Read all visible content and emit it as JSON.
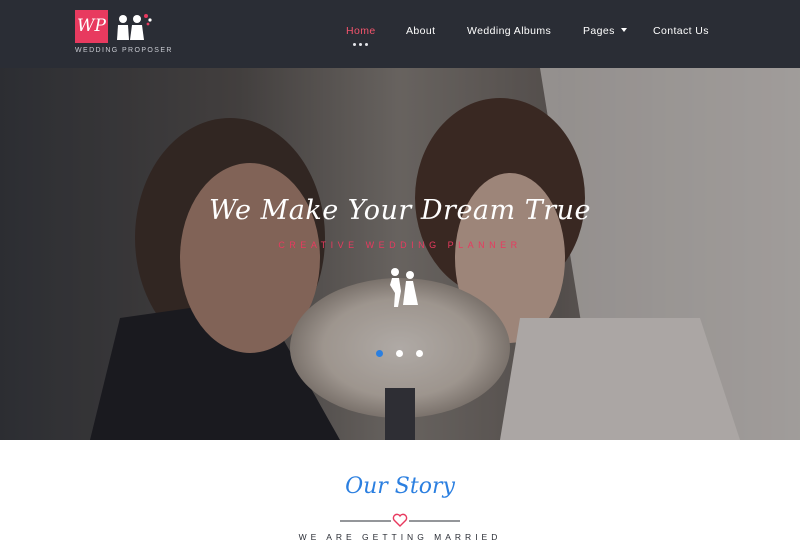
{
  "brand": {
    "logo_letters": "WP",
    "name": "WEDDING PROPOSER",
    "accent": "#e83a5f"
  },
  "nav": {
    "items": [
      {
        "label": "Home",
        "active": true
      },
      {
        "label": "About",
        "active": false
      },
      {
        "label": "Wedding Albums",
        "active": false
      },
      {
        "label": "Pages",
        "active": false,
        "has_dropdown": true
      },
      {
        "label": "Contact Us",
        "active": false
      }
    ]
  },
  "hero": {
    "title": "We Make Your Dream True",
    "subtitle": "CREATIVE WEDDING PLANNER",
    "icon": "couple-dancing-icon",
    "slides": 3,
    "active_slide": 1
  },
  "story": {
    "title": "Our Story",
    "subtitle": "WE ARE GETTING MARRIED",
    "divider_icon": "heart-icon",
    "accent": "#2b7fe0"
  }
}
